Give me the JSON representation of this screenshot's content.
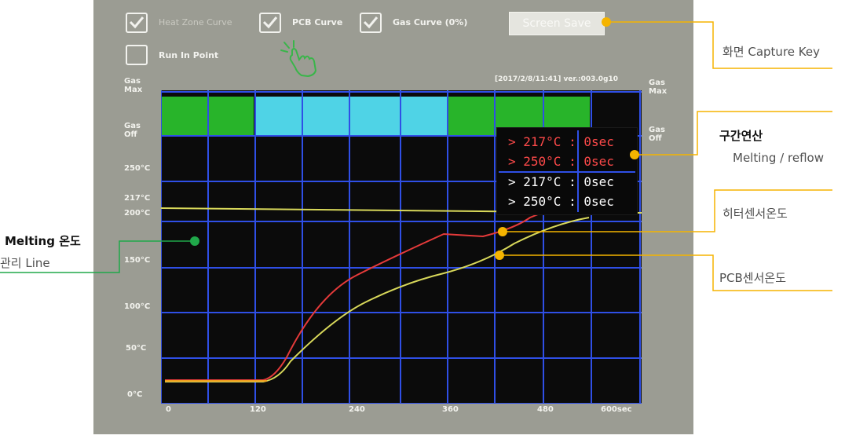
{
  "toolbar": {
    "heat_zone_label": "Heat Zone Curve",
    "heat_zone_checked": true,
    "pcb_label": "PCB Curve",
    "pcb_checked": true,
    "gas_label": "Gas Curve (0%)",
    "gas_checked": true,
    "run_in_point_label": "Run In Point",
    "run_in_point_checked": false,
    "screen_save_label": "Screen Save"
  },
  "graph": {
    "timestamp": "[2017/2/8/11:41] ver.:003.0g10",
    "y_labels": {
      "gas_max": "Gas\nMax",
      "gas_off": "Gas\nOff",
      "t250": "250°C",
      "t217": "217°C",
      "t200": "200°C",
      "t150": "150°C",
      "t100": "100°C",
      "t50": "50°C",
      "t0": "0°C"
    },
    "right_labels": {
      "gas_max": "Gas\nMax",
      "gas_off": "Gas\nOff"
    },
    "x_labels": [
      "0",
      "120",
      "240",
      "360",
      "480",
      "600sec"
    ],
    "melting_line_temp": 217,
    "colors": {
      "grid": "#2f4fe6",
      "gas_on": "#28b42a",
      "gas_zone": "#4fd3e6",
      "heater_curve": "#e53a3a",
      "pcb_curve": "#d8d85a",
      "melting_line": "#d8d85a",
      "accent_orange": "#f5b400",
      "accent_green": "#20a84a"
    }
  },
  "interval_calc": {
    "rows": [
      {
        "label": "> 217°C : 0sec",
        "color": "red"
      },
      {
        "label": "> 250°C : 0sec",
        "color": "red"
      },
      {
        "label": "> 217°C : 0sec",
        "color": "white"
      },
      {
        "label": "> 250°C : 0sec",
        "color": "white"
      }
    ]
  },
  "annotations": {
    "capture_key": "화면 Capture Key",
    "interval_title": "구간연산",
    "interval_sub": "Melting / reflow",
    "heater_sensor": "히터센서온도",
    "pcb_sensor": "PCB센서온도",
    "melting_title": "Melting 온도",
    "melting_sub": "관리 Line"
  }
}
